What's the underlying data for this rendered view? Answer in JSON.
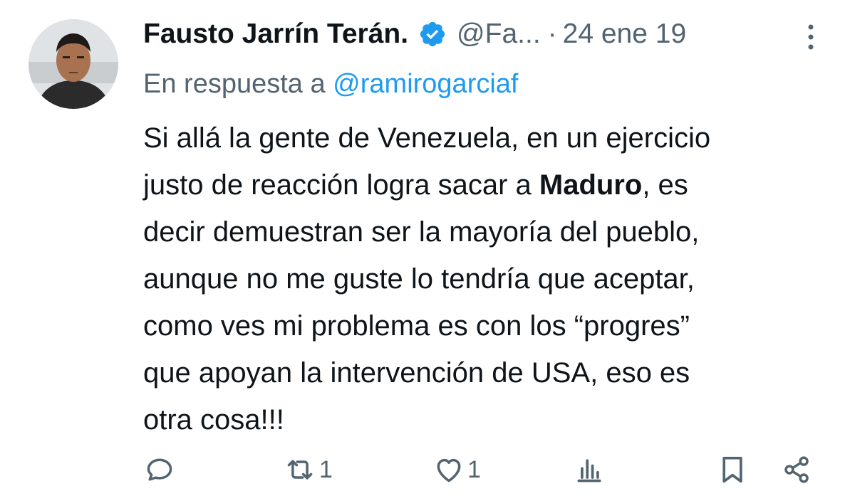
{
  "tweet": {
    "author_name": "Fausto Jarrín Terán.",
    "handle": "@Fa...",
    "separator": "·",
    "date": "24 ene 19",
    "reply_prefix": "En respuesta a",
    "reply_to": "@ramirogarciaf",
    "text": {
      "line1": "Si allá la gente de Venezuela, en un ejercicio",
      "line2_before": "justo de reacción logra sacar a",
      "line2_bold": "Maduro",
      "line2_after": ", es",
      "line3": "decir demuestran ser la mayoría del pueblo,",
      "line4": "aunque no me guste lo tendría que aceptar,",
      "line5": "como ves mi problema es con los “progres”",
      "line6": "que apoyan la intervención de USA, eso es",
      "line7": "otra cosa!!!"
    }
  },
  "actions": {
    "reply_icon": "reply-icon",
    "retweet_icon": "retweet-icon",
    "retweet_count": "1",
    "like_icon": "heart-icon",
    "like_count": "1",
    "views_icon": "views-icon",
    "bookmark_icon": "bookmark-icon",
    "share_icon": "share-icon"
  },
  "colors": {
    "text_primary": "#0f1419",
    "text_secondary": "#536471",
    "link": "#1d9bf0",
    "verified_badge": "#1d9bf0"
  }
}
